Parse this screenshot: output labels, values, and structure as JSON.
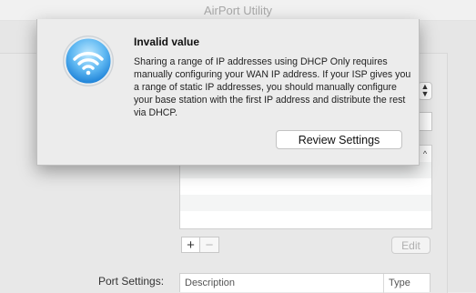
{
  "window": {
    "title": "AirPort Utility"
  },
  "alert": {
    "title": "Invalid value",
    "message": "Sharing a range of IP addresses using DHCP Only requires manually configuring your WAN IP address. If your ISP gives you a range of static IP addresses, you should manually configure your base station with the first IP address and distribute the rest via DHCP.",
    "button_label": "Review Settings",
    "icon": "airport-utility-wifi-icon"
  },
  "list_controls": {
    "add_label": "+",
    "remove_label": "−",
    "edit_label": "Edit"
  },
  "port_settings": {
    "label": "Port Settings:",
    "columns": [
      "Description",
      "Type"
    ]
  },
  "colors": {
    "icon_blue": "#1a8ce6",
    "icon_light": "#7fd0ff"
  }
}
